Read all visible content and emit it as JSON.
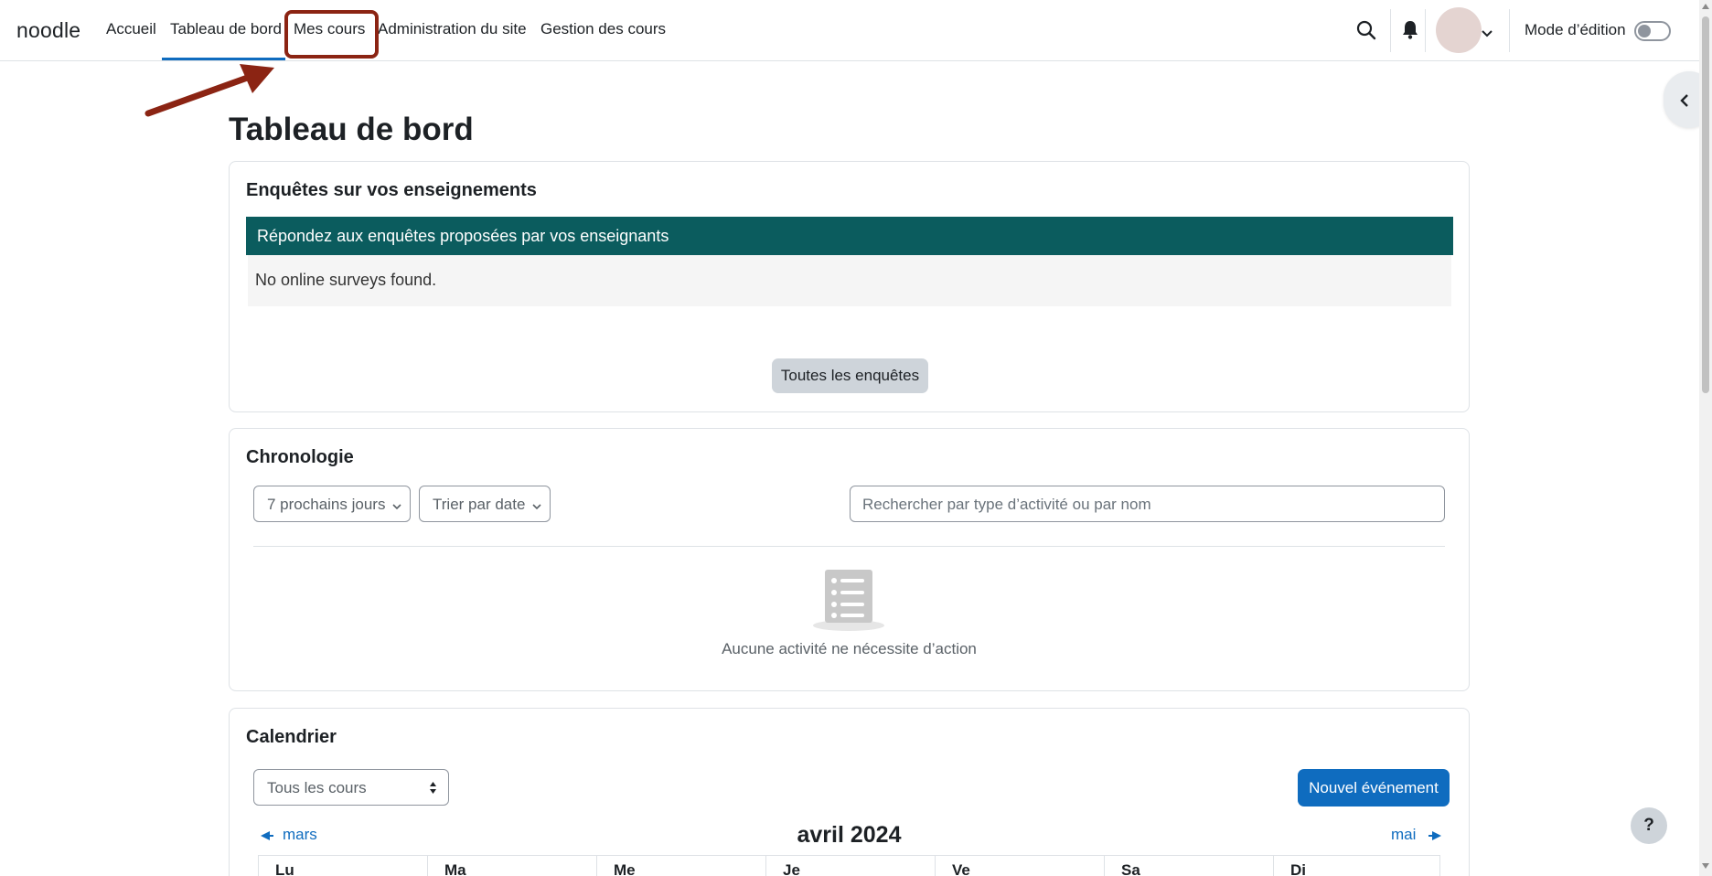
{
  "navbar": {
    "brand": "noodle",
    "items": [
      {
        "label": "Accueil"
      },
      {
        "label": "Tableau de bord"
      },
      {
        "label": "Mes cours"
      },
      {
        "label": "Administration du site"
      },
      {
        "label": "Gestion des cours"
      }
    ],
    "active_item": "Tableau de bord",
    "highlighted_item": "Mes cours",
    "edit_mode_label": "Mode d’édition",
    "edit_mode_on": false,
    "icons": [
      "search-icon",
      "bell-icon",
      "avatar",
      "chevron-down-icon"
    ]
  },
  "page": {
    "title": "Tableau de bord"
  },
  "surveys_block": {
    "title": "Enquêtes sur vos enseignements",
    "header": "Répondez aux enquêtes proposées par vos enseignants",
    "empty_message": "No online surveys found.",
    "button_label": "Toutes les enquêtes"
  },
  "timeline_block": {
    "title": "Chronologie",
    "filter_label": "7 prochains jours",
    "sort_label": "Trier par date",
    "search_placeholder": "Rechercher par type d’activité ou par nom",
    "empty_message": "Aucune activité ne nécessite d’action"
  },
  "calendar_block": {
    "title": "Calendrier",
    "course_select": "Tous les cours",
    "new_event_label": "Nouvel événement",
    "prev_month": "mars",
    "next_month": "mai",
    "current_month": "avril 2024",
    "day_headers": [
      "Lu",
      "Ma",
      "Me",
      "Je",
      "Ve",
      "Sa",
      "Di"
    ]
  },
  "help_button": "?",
  "colors": {
    "primary": "#0f6cbf",
    "survey_header_bg": "#0b5c5e",
    "annotation": "#8b2413"
  }
}
